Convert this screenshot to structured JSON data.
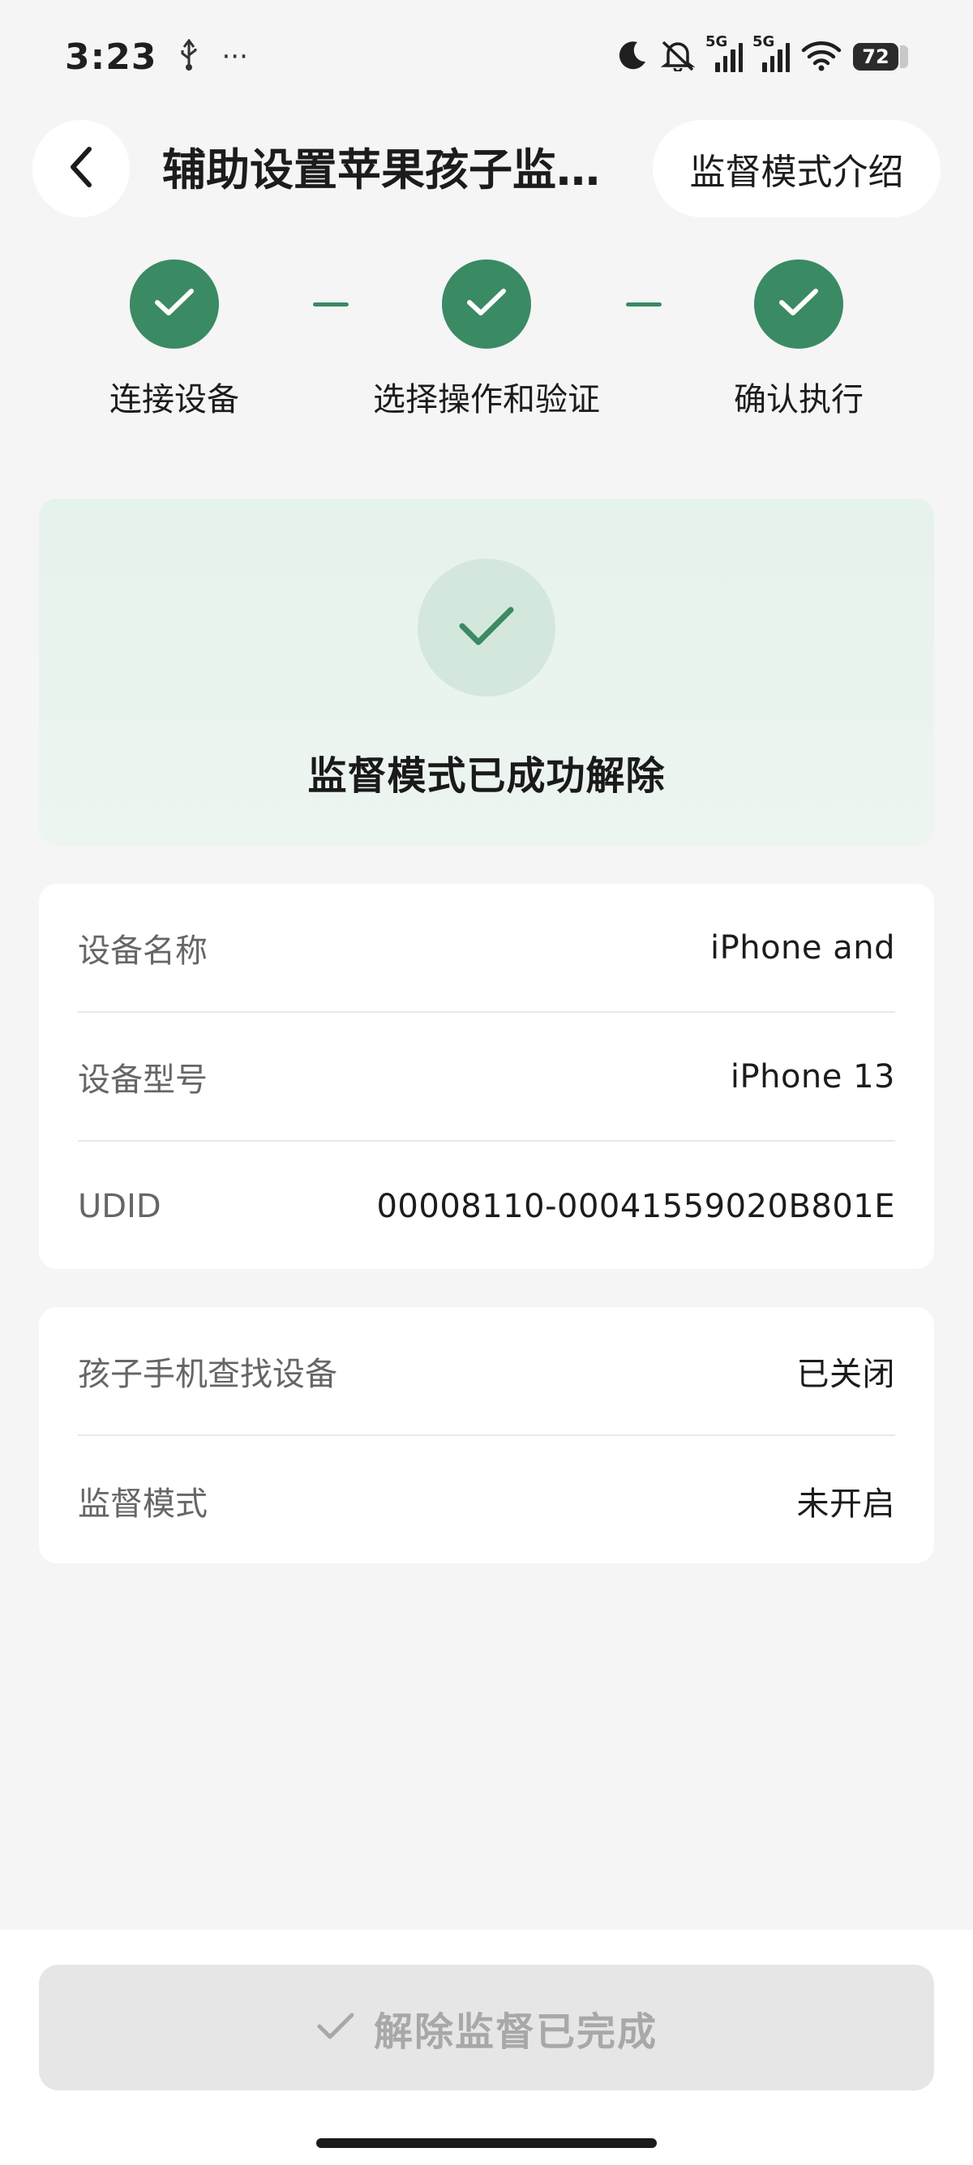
{
  "status_bar": {
    "time": "3:23",
    "usb_icon": "usb-icon",
    "more": "···",
    "net1": "5G",
    "net2": "5G",
    "battery": "72"
  },
  "header": {
    "title": "辅助设置苹果孩子监督模式",
    "intro_button": "监督模式介绍"
  },
  "steps": [
    {
      "label": "连接设备",
      "done": true
    },
    {
      "label": "选择操作和验证",
      "done": true
    },
    {
      "label": "确认执行",
      "done": true
    }
  ],
  "success": {
    "message": "监督模式已成功解除"
  },
  "device_info": [
    {
      "label": "设备名称",
      "value": "iPhone and"
    },
    {
      "label": "设备型号",
      "value": "iPhone 13"
    },
    {
      "label": "UDID",
      "value": "00008110-00041559020B801E"
    }
  ],
  "status_info": [
    {
      "label": "孩子手机查找设备",
      "value": "已关闭"
    },
    {
      "label": "监督模式",
      "value": "未开启"
    }
  ],
  "footer": {
    "done_label": "解除监督已完成"
  },
  "colors": {
    "accent": "#3a8a64",
    "success_bg": "#e6f2ec",
    "page_bg": "#f5f5f5"
  }
}
